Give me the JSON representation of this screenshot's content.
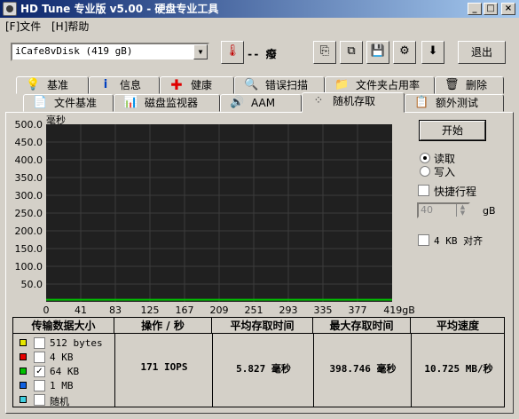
{
  "window": {
    "title": "HD Tune 专业版 v5.00 - 硬盘专业工具",
    "min": "_",
    "max": "□",
    "close": "×"
  },
  "menu": {
    "file": "[F]文件",
    "help": "[H]帮助"
  },
  "toolbar": {
    "drive": "iCafe8vDisk (419 gB)",
    "temperature": "-- 癈",
    "exit": "退出"
  },
  "tabs_top": [
    "基准",
    "信息",
    "健康",
    "错误扫描",
    "文件夹占用率",
    "删除"
  ],
  "tabs_bottom": [
    "文件基准",
    "磁盘监视器",
    "AAM",
    "随机存取",
    "额外测试"
  ],
  "chart": {
    "unit": "毫秒",
    "y_ticks": [
      "500.0",
      "450.0",
      "400.0",
      "350.0",
      "300.0",
      "250.0",
      "200.0",
      "150.0",
      "100.0",
      "50.0"
    ],
    "x_ticks": [
      "0",
      "41",
      "83",
      "125",
      "167",
      "209",
      "251",
      "293",
      "335",
      "377",
      "419gB"
    ]
  },
  "controls": {
    "start": "开始",
    "read": "读取",
    "write": "写入",
    "quick": "快捷行程",
    "quick_value": "40",
    "quick_unit": "gB",
    "align": "4 KB 对齐"
  },
  "table": {
    "headers": [
      "传输数据大小",
      "操作 / 秒",
      "平均存取时间",
      "最大存取时间",
      "平均速度"
    ],
    "rows": [
      {
        "label": "512 bytes",
        "color": "#e6e600",
        "checked": false
      },
      {
        "label": "4 KB",
        "color": "#e60000",
        "checked": false
      },
      {
        "label": "64 KB",
        "color": "#00c000",
        "checked": true
      },
      {
        "label": "1 MB",
        "color": "#1060e0",
        "checked": false
      },
      {
        "label": "随机",
        "color": "#40d0e0",
        "checked": false
      }
    ],
    "values": {
      "ops": "171 IOPS",
      "avg": "5.827 毫秒",
      "max": "398.746 毫秒",
      "speed": "10.725 MB/秒"
    }
  },
  "chart_data": {
    "type": "scatter",
    "ylabel": "毫秒",
    "ylim": [
      0,
      500
    ],
    "xlim": [
      0,
      419
    ],
    "x_unit": "gB",
    "series": [
      {
        "name": "64 KB",
        "color": "#00c000",
        "x": [
          0,
          419
        ],
        "y": [
          6,
          6
        ]
      }
    ]
  }
}
